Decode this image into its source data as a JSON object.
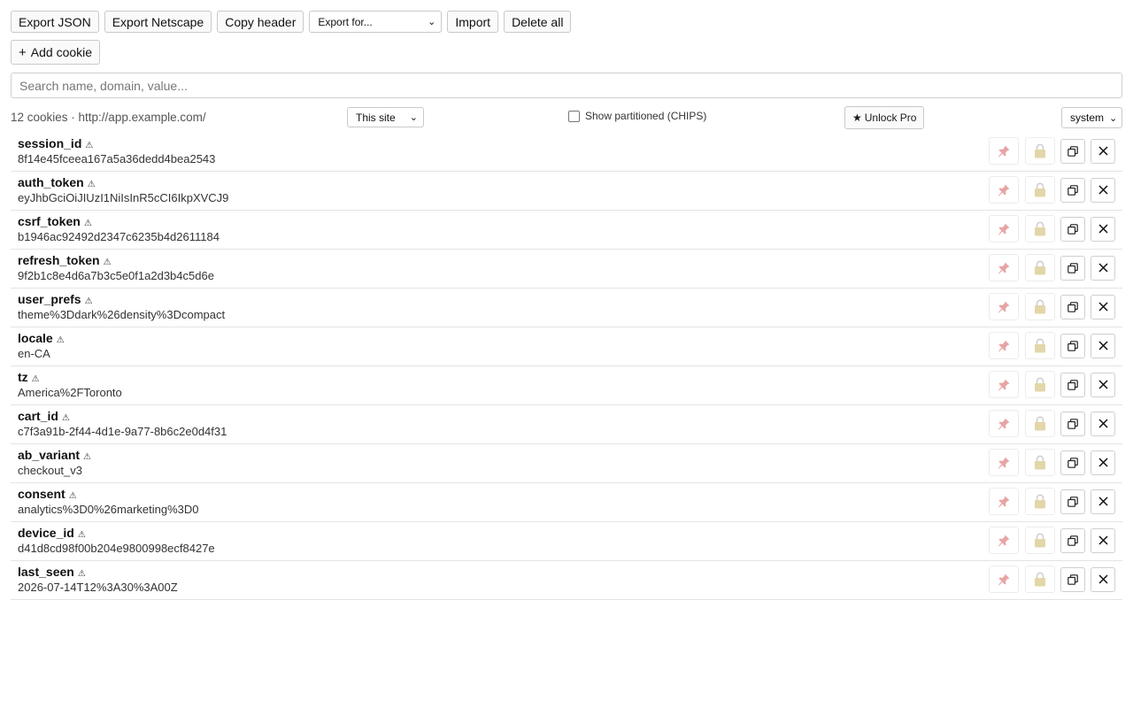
{
  "toolbar": {
    "export_json": "Export JSON",
    "export_netscape": "Export Netscape",
    "copy_header": "Copy header",
    "export_for": "Export for...",
    "import": "Import",
    "delete_all": "Delete all"
  },
  "add_cookie": "Add cookie",
  "search": {
    "placeholder": "Search name, domain, value..."
  },
  "status": {
    "count": "12 cookies · http://app.example.com/",
    "scope": "This site",
    "partitioned": "Show partitioned (CHIPS)",
    "partitioned_checked": false,
    "pro": "Unlock Pro",
    "theme": "system"
  },
  "colors": {
    "pin": "#e8a4a4",
    "lock": "#d6c38a",
    "border": "#e4e4e4"
  },
  "cookies": [
    {
      "name": "session_id",
      "value": "8f14e45fceea167a5a36dedd4bea2543"
    },
    {
      "name": "auth_token",
      "value": "eyJhbGciOiJIUzI1NiIsInR5cCI6IkpXVCJ9"
    },
    {
      "name": "csrf_token",
      "value": "b1946ac92492d2347c6235b4d2611184"
    },
    {
      "name": "refresh_token",
      "value": "9f2b1c8e4d6a7b3c5e0f1a2d3b4c5d6e"
    },
    {
      "name": "user_prefs",
      "value": "theme%3Ddark%26density%3Dcompact"
    },
    {
      "name": "locale",
      "value": "en-CA"
    },
    {
      "name": "tz",
      "value": "America%2FToronto"
    },
    {
      "name": "cart_id",
      "value": "c7f3a91b-2f44-4d1e-9a77-8b6c2e0d4f31"
    },
    {
      "name": "ab_variant",
      "value": "checkout_v3"
    },
    {
      "name": "consent",
      "value": "analytics%3D0%26marketing%3D0"
    },
    {
      "name": "device_id",
      "value": "d41d8cd98f00b204e9800998ecf8427e"
    },
    {
      "name": "last_seen",
      "value": "2026-07-14T12%3A30%3A00Z"
    }
  ]
}
